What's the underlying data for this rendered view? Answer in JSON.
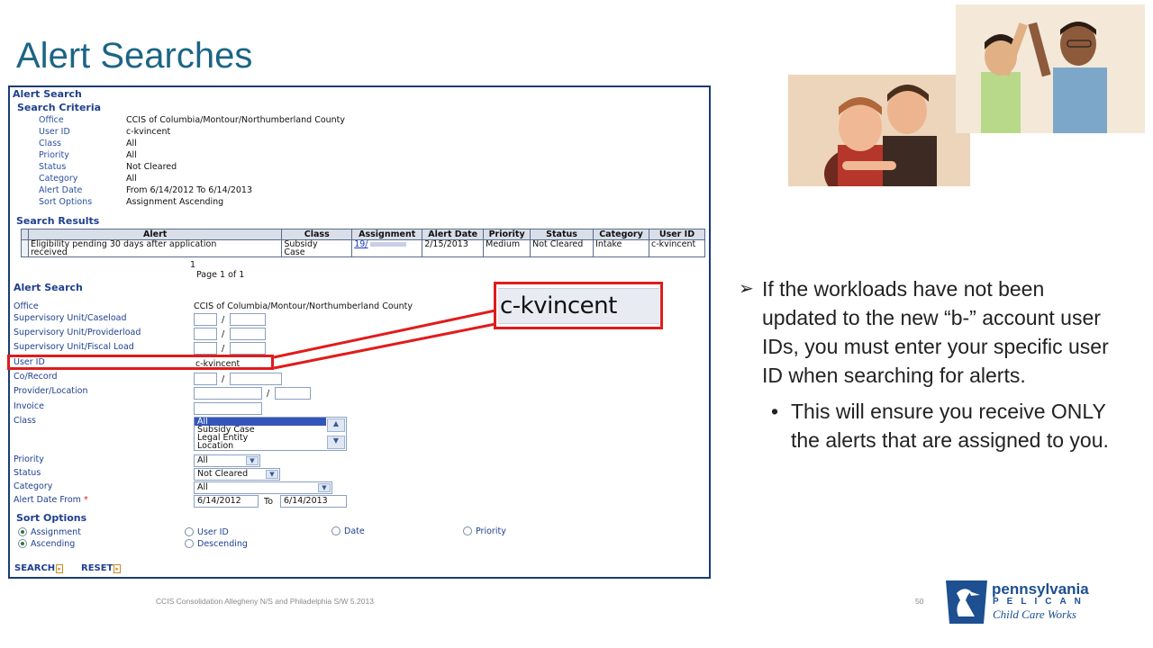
{
  "slide": {
    "title": "Alert Searches",
    "footer": "CCIS Consolidation Allegheny N/S and Philadelphia S/W 5.2013",
    "page_number": "50"
  },
  "screenshot": {
    "panel_title": "Alert Search",
    "criteria_title": "Search Criteria",
    "criteria": [
      {
        "label": "Office",
        "value": "CCIS of Columbia/Montour/Northumberland County"
      },
      {
        "label": "User ID",
        "value": "c-kvincent"
      },
      {
        "label": "Class",
        "value": "All"
      },
      {
        "label": "Priority",
        "value": "All"
      },
      {
        "label": "Status",
        "value": "Not Cleared"
      },
      {
        "label": "Category",
        "value": "All"
      },
      {
        "label": "Alert Date",
        "value": "From 6/14/2012 To 6/14/2013"
      },
      {
        "label": "Sort Options",
        "value": "Assignment Ascending"
      }
    ],
    "results_title": "Search Results",
    "results_headers": [
      "Alert",
      "Class",
      "Assignment",
      "Alert Date",
      "Priority",
      "Status",
      "Category",
      "User ID"
    ],
    "results_row": {
      "alert_line1": "Eligibility pending 30 days after application",
      "alert_line2": "received",
      "class_line1": "Subsidy",
      "class_line2": "Case",
      "assignment": "19/",
      "alert_date": "2/15/2013",
      "priority": "Medium",
      "status": "Not Cleared",
      "category": "Intake",
      "user_id": "c-kvincent"
    },
    "pager_number": "1",
    "pager_text": "Page 1 of 1",
    "form": {
      "title": "Alert Search",
      "office_label": "Office",
      "office_value": "CCIS of Columbia/Montour/Northumberland County",
      "sup_caseload_label": "Supervisory Unit/Caseload",
      "sup_provider_label": "Supervisory Unit/Providerload",
      "sup_fiscal_label": "Supervisory Unit/Fiscal Load",
      "userid_label": "User ID",
      "userid_value": "c-kvincent",
      "corecord_label": "Co/Record",
      "provider_label": "Provider/Location",
      "invoice_label": "Invoice",
      "class_label": "Class",
      "class_options": [
        "All",
        "Subsidy Case",
        "Legal Entity",
        "Location"
      ],
      "priority_label": "Priority",
      "priority_value": "All",
      "status_label": "Status",
      "status_value": "Not Cleared",
      "category_label": "Category",
      "category_value": "All",
      "alert_date_label": "Alert Date From",
      "required_mark": "*",
      "date_from": "6/14/2012",
      "date_to_label": "To",
      "date_to": "6/14/2013",
      "slash": "/"
    },
    "sort": {
      "title": "Sort Options",
      "options": {
        "assignment": "Assignment",
        "user_id": "User ID",
        "date": "Date",
        "priority": "Priority",
        "ascending": "Ascending",
        "descending": "Descending"
      },
      "selected_field": "Assignment",
      "selected_order": "Ascending"
    },
    "actions": {
      "search": "SEARCH",
      "reset": "RESET"
    }
  },
  "zoom_callout": "c-kvincent",
  "bullets": {
    "main_marker": "➢",
    "main": "If the workloads have not been updated to the new “b-” account user IDs, you must enter your specific user ID when searching for alerts.",
    "sub_marker": "•",
    "sub": "This will ensure you receive ONLY the alerts that are assigned to you."
  },
  "logo": {
    "line1": "pennsylvania",
    "line2": "PELICAN",
    "line3": "Child Care Works"
  },
  "colors": {
    "title": "#1b6585",
    "highlight": "#e01c1c",
    "ui_blue": "#1f3f8f",
    "logo_blue": "#1d4f91"
  }
}
